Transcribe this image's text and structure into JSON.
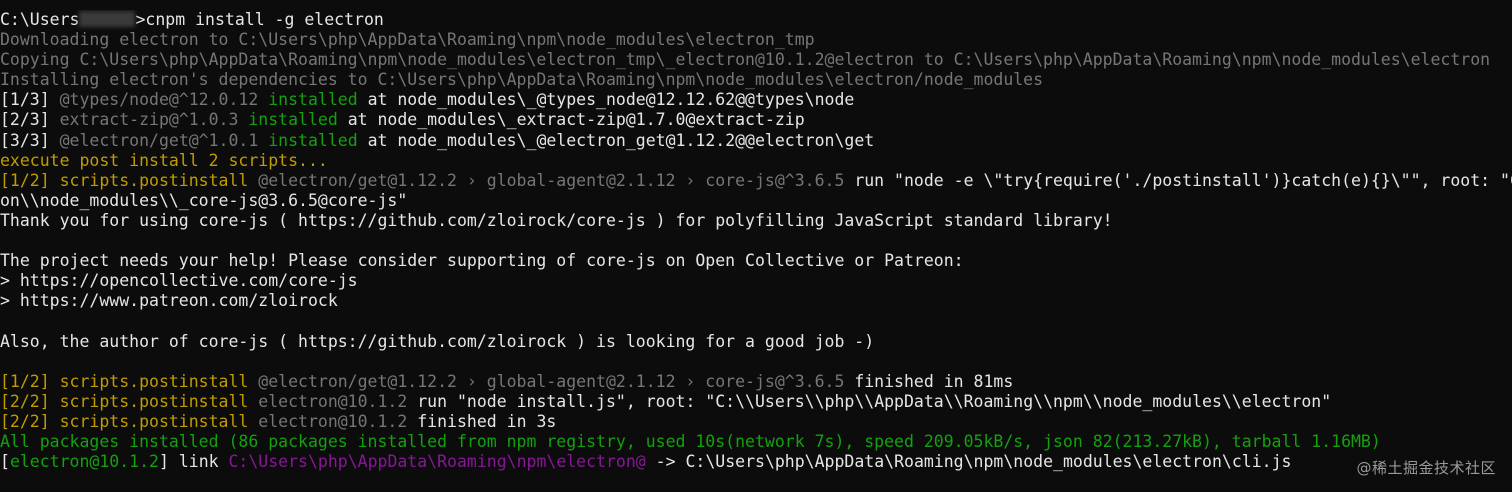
{
  "terminal": {
    "lines": [
      [
        {
          "text": "C:\\Users",
          "color": "default"
        },
        {
          "redacted": true
        },
        {
          "text": ">cnpm install -g electron",
          "color": "default"
        }
      ],
      [
        {
          "text": "Downloading electron to C:\\Users\\php\\AppData\\Roaming\\npm\\node_modules\\electron_tmp",
          "color": "gray"
        }
      ],
      [
        {
          "text": "Copying C:\\Users\\php\\AppData\\Roaming\\npm\\node_modules\\electron_tmp\\_electron@10.1.2@electron to C:\\Users\\php\\AppData\\Roaming\\npm\\node_modules\\electron",
          "color": "gray"
        }
      ],
      [
        {
          "text": "Installing electron's dependencies to C:\\Users\\php\\AppData\\Roaming\\npm\\node_modules\\electron/node_modules",
          "color": "gray"
        }
      ],
      [
        {
          "text": "[1/3] ",
          "color": "default"
        },
        {
          "text": "@types/node@^12.0.12 ",
          "color": "gray"
        },
        {
          "text": "installed",
          "color": "green"
        },
        {
          "text": " at node_modules\\_@types_node@12.12.62@@types\\node",
          "color": "default"
        }
      ],
      [
        {
          "text": "[2/3] ",
          "color": "default"
        },
        {
          "text": "extract-zip@^1.0.3 ",
          "color": "gray"
        },
        {
          "text": "installed",
          "color": "green"
        },
        {
          "text": " at node_modules\\_extract-zip@1.7.0@extract-zip",
          "color": "default"
        }
      ],
      [
        {
          "text": "[3/3] ",
          "color": "default"
        },
        {
          "text": "@electron/get@^1.0.1 ",
          "color": "gray"
        },
        {
          "text": "installed",
          "color": "green"
        },
        {
          "text": " at node_modules\\_@electron_get@1.12.2@@electron\\get",
          "color": "default"
        }
      ],
      [
        {
          "text": "execute post install 2 scripts...",
          "color": "yellow"
        }
      ],
      [
        {
          "text": "[1/2] scripts.postinstall ",
          "color": "yellow"
        },
        {
          "text": "@electron/get@1.12.2 › global-agent@2.1.12 › core-js@^3.6.5 ",
          "color": "gray"
        },
        {
          "text": "run \"node -e \\\"try{require('./postinstall')}catch(e){}\\\"\", root: \"C:\\\\Users\\\\php\\\\AppData\\\\Roaming\\\\npm\\\\node_modules\\\\electr",
          "color": "default"
        }
      ],
      [
        {
          "text": "on\\\\node_modules\\\\_core-js@3.6.5@core-js\"",
          "color": "default"
        }
      ],
      [
        {
          "text": "Thank you for using core-js ( https://github.com/zloirock/core-js ) for polyfilling JavaScript standard library!",
          "color": "default"
        }
      ],
      [],
      [
        {
          "text": "The project needs your help! Please consider supporting of core-js on Open Collective or Patreon:",
          "color": "default"
        }
      ],
      [
        {
          "text": "> https://opencollective.com/core-js",
          "color": "default"
        }
      ],
      [
        {
          "text": "> https://www.patreon.com/zloirock",
          "color": "default"
        }
      ],
      [],
      [
        {
          "text": "Also, the author of core-js ( https://github.com/zloirock ) is looking for a good job -)",
          "color": "default"
        }
      ],
      [],
      [
        {
          "text": "[1/2] scripts.postinstall ",
          "color": "yellow"
        },
        {
          "text": "@electron/get@1.12.2 › global-agent@2.1.12 › core-js@^3.6.5 ",
          "color": "gray"
        },
        {
          "text": "finished in 81ms",
          "color": "default"
        }
      ],
      [
        {
          "text": "[2/2] scripts.postinstall ",
          "color": "yellow"
        },
        {
          "text": "electron@10.1.2 ",
          "color": "gray"
        },
        {
          "text": "run \"node install.js\", root: \"C:\\\\Users\\\\php\\\\AppData\\\\Roaming\\\\npm\\\\node_modules\\\\electron\"",
          "color": "default"
        }
      ],
      [
        {
          "text": "[2/2] scripts.postinstall ",
          "color": "yellow"
        },
        {
          "text": "electron@10.1.2 ",
          "color": "gray"
        },
        {
          "text": "finished in 3s",
          "color": "default"
        }
      ],
      [
        {
          "text": "All packages installed (86 packages installed from npm registry, used 10s(network 7s), speed 209.05kB/s, json 82(213.27kB), tarball 1.16MB)",
          "color": "green"
        }
      ],
      [
        {
          "text": "[",
          "color": "default"
        },
        {
          "text": "electron@10.1.2",
          "color": "green"
        },
        {
          "text": "] link ",
          "color": "default"
        },
        {
          "text": "C:\\Users\\php\\AppData\\Roaming\\npm\\electron@",
          "color": "magenta"
        },
        {
          "text": " -> C:\\Users\\php\\AppData\\Roaming\\npm\\node_modules\\electron\\cli.js",
          "color": "default"
        }
      ]
    ]
  },
  "watermark": "@稀土掘金技术社区",
  "colors": {
    "background": "#0c0c0c",
    "default": "#e6e6e6",
    "gray": "#767676",
    "green": "#13a10e",
    "yellow": "#c19c00",
    "magenta": "#881798"
  }
}
